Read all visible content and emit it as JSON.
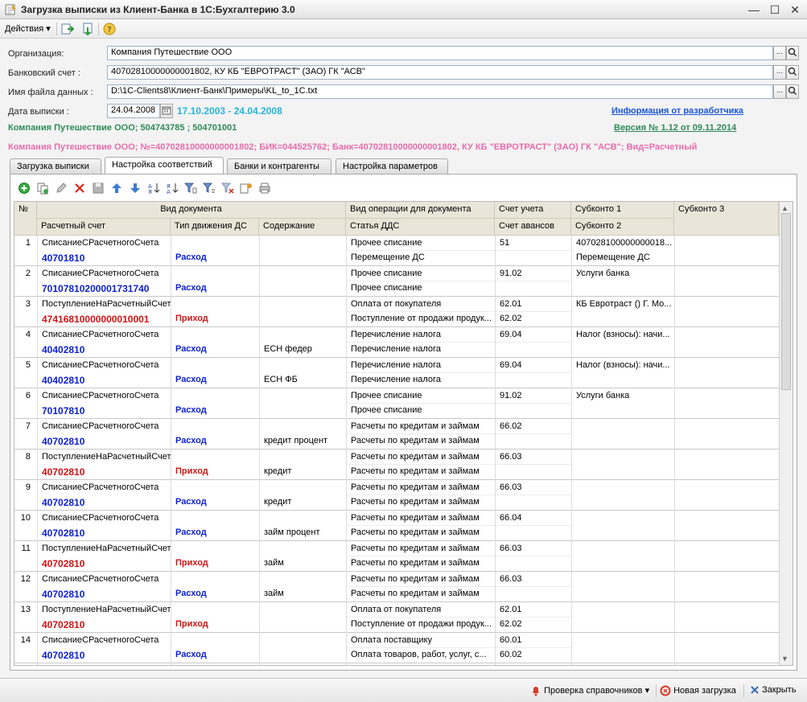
{
  "window": {
    "title": "Загрузка выписки из Клиент-Банка в 1С:Бухгалтерию 3.0"
  },
  "toolbar": {
    "actions_label": "Действия"
  },
  "form": {
    "org_label": "Организация:",
    "org_value": "Компания Путешествие ООО",
    "bank_label": "Банковский счет :",
    "bank_value": "40702810000000001802, КУ КБ \"ЕВРОТРАСТ\" (ЗАО) ГК \"АСВ\"",
    "file_label": "Имя файла данных :",
    "file_value": "D:\\1C-Clients8\\Клиент-Банк\\Примеры\\KL_to_1C.txt",
    "date_label": "Дата выписки :",
    "date_value": "24.04.2008",
    "period_text": "17.10.2003 - 24.04.2008",
    "dev_info_link": "Информация от разработчика",
    "org_info": "Компания Путешествие ООО; 504743785 ; 504701001",
    "version_link": "Версия № 1.12 от 09.11.2014",
    "account_info": "Компания Путешествие ООО; №=40702810000000001802; БИК=044525762; Банк=40702810000000001802, КУ КБ \"ЕВРОТРАСТ\" (ЗАО) ГК \"АСВ\"; Вид=Расчетный"
  },
  "colors": {
    "accent_green": "#2e8b57",
    "period_cyan": "#26b4d9",
    "link_blue": "#1a55d6",
    "pink": "#e86bab",
    "expense_blue": "#0b1fd1",
    "income_red": "#d11313"
  },
  "tabs": [
    {
      "label": "Загрузка выписки",
      "active": false
    },
    {
      "label": "Настройка соответствий",
      "active": true
    },
    {
      "label": "Банки и контрагенты",
      "active": false
    },
    {
      "label": "Настройка параметров",
      "active": false
    }
  ],
  "grid": {
    "headers": {
      "num": "№",
      "doc_type": "Вид документа",
      "account": "Расчетный счет",
      "movement": "Тип движения ДС",
      "content": "Содержание",
      "op_type": "Вид операции для документа",
      "dds": "Статья ДДС",
      "schet": "Счет учета",
      "schet_av": "Счет авансов",
      "sub1": "Субконто 1",
      "sub2": "Субконто 2",
      "sub3": "Субконто 3"
    },
    "rows": [
      {
        "n": "1",
        "doc": "СписаниеСРасчетногоСчета",
        "acct": "40701810",
        "dir": "Расход",
        "income": false,
        "content": "",
        "op": "Прочее списание",
        "dds": "Перемещение ДС",
        "schet": "51",
        "schet2": "",
        "sub1": "407028100000000018...",
        "sub2": "Перемещение ДС"
      },
      {
        "n": "2",
        "doc": "СписаниеСРасчетногоСчета",
        "acct": "70107810200001731740",
        "dir": "Расход",
        "income": false,
        "content": "",
        "op": "Прочее списание",
        "dds": "Прочее списание",
        "schet": "91.02",
        "schet2": "",
        "sub1": "Услуги банка",
        "sub2": ""
      },
      {
        "n": "3",
        "doc": "ПоступлениеНаРасчетныйСчет",
        "acct": "47416810000000010001",
        "dir": "Приход",
        "income": true,
        "content": "",
        "op": "Оплата от покупателя",
        "dds": "Поступление от продажи продук...",
        "schet": "62.01",
        "schet2": "62.02",
        "sub1": "КБ Евротраст () Г. Мо...",
        "sub2": ""
      },
      {
        "n": "4",
        "doc": "СписаниеСРасчетногоСчета",
        "acct": "40402810",
        "dir": "Расход",
        "income": false,
        "content": "ЕСН федер",
        "op": "Перечисление налога",
        "dds": "Перечисление налога",
        "schet": "69.04",
        "schet2": "",
        "sub1": "Налог (взносы): начи...",
        "sub2": ""
      },
      {
        "n": "5",
        "doc": "СписаниеСРасчетногоСчета",
        "acct": "40402810",
        "dir": "Расход",
        "income": false,
        "content": "ЕСН ФБ",
        "op": "Перечисление налога",
        "dds": "Перечисление налога",
        "schet": "69.04",
        "schet2": "",
        "sub1": "Налог (взносы): начи...",
        "sub2": ""
      },
      {
        "n": "6",
        "doc": "СписаниеСРасчетногоСчета",
        "acct": "70107810",
        "dir": "Расход",
        "income": false,
        "content": "",
        "op": "Прочее списание",
        "dds": "Прочее списание",
        "schet": "91.02",
        "schet2": "",
        "sub1": "Услуги банка",
        "sub2": ""
      },
      {
        "n": "7",
        "doc": "СписаниеСРасчетногоСчета",
        "acct": "40702810",
        "dir": "Расход",
        "income": false,
        "content": "кредит процент",
        "op": "Расчеты по кредитам и займам",
        "dds": "Расчеты по кредитам и займам",
        "schet": "66.02",
        "schet2": "",
        "sub1": "",
        "sub2": ""
      },
      {
        "n": "8",
        "doc": "ПоступлениеНаРасчетныйСчет",
        "acct": "40702810",
        "dir": "Приход",
        "income": true,
        "content": "кредит",
        "op": "Расчеты по кредитам и займам",
        "dds": "Расчеты по кредитам и займам",
        "schet": "66.03",
        "schet2": "",
        "sub1": "",
        "sub2": ""
      },
      {
        "n": "9",
        "doc": "СписаниеСРасчетногоСчета",
        "acct": "40702810",
        "dir": "Расход",
        "income": false,
        "content": "кредит",
        "op": "Расчеты по кредитам и займам",
        "dds": "Расчеты по кредитам и займам",
        "schet": "66.03",
        "schet2": "",
        "sub1": "",
        "sub2": ""
      },
      {
        "n": "10",
        "doc": "СписаниеСРасчетногоСчета",
        "acct": "40702810",
        "dir": "Расход",
        "income": false,
        "content": "займ процент",
        "op": "Расчеты по кредитам и займам",
        "dds": "Расчеты по кредитам и займам",
        "schet": "66.04",
        "schet2": "",
        "sub1": "",
        "sub2": ""
      },
      {
        "n": "11",
        "doc": "ПоступлениеНаРасчетныйСчет",
        "acct": "40702810",
        "dir": "Приход",
        "income": true,
        "content": "займ",
        "op": "Расчеты по кредитам и займам",
        "dds": "Расчеты по кредитам и займам",
        "schet": "66.03",
        "schet2": "",
        "sub1": "",
        "sub2": ""
      },
      {
        "n": "12",
        "doc": "СписаниеСРасчетногоСчета",
        "acct": "40702810",
        "dir": "Расход",
        "income": false,
        "content": "займ",
        "op": "Расчеты по кредитам и займам",
        "dds": "Расчеты по кредитам и займам",
        "schet": "66.03",
        "schet2": "",
        "sub1": "",
        "sub2": ""
      },
      {
        "n": "13",
        "doc": "ПоступлениеНаРасчетныйСчет",
        "acct": "40702810",
        "dir": "Приход",
        "income": true,
        "content": "",
        "op": "Оплата от покупателя",
        "dds": "Поступление от продажи продук...",
        "schet": "62.01",
        "schet2": "62.02",
        "sub1": "",
        "sub2": ""
      },
      {
        "n": "14",
        "doc": "СписаниеСРасчетногоСчета",
        "acct": "40702810",
        "dir": "Расход",
        "income": false,
        "content": "",
        "op": "Оплата поставщику",
        "dds": "Оплата товаров, работ, услуг, с...",
        "schet": "60.01",
        "schet2": "60.02",
        "sub1": "",
        "sub2": ""
      }
    ]
  },
  "statusbar": {
    "check_refs": "Проверка справочников",
    "new_load": "Новая загрузка",
    "close": "Закрыть"
  },
  "icons": [
    "app-icon",
    "minimize-icon",
    "maximize-icon",
    "close-icon",
    "import-icon",
    "export-icon",
    "help-icon",
    "calendar-icon",
    "select-icon",
    "search-icon",
    "add-icon",
    "copy-icon",
    "edit-icon",
    "delete-icon",
    "move-up-icon",
    "move-down-icon",
    "sort-asc-icon",
    "sort-desc-icon",
    "filter-icon",
    "bell-icon",
    "refresh-icon",
    "close-x-icon"
  ]
}
